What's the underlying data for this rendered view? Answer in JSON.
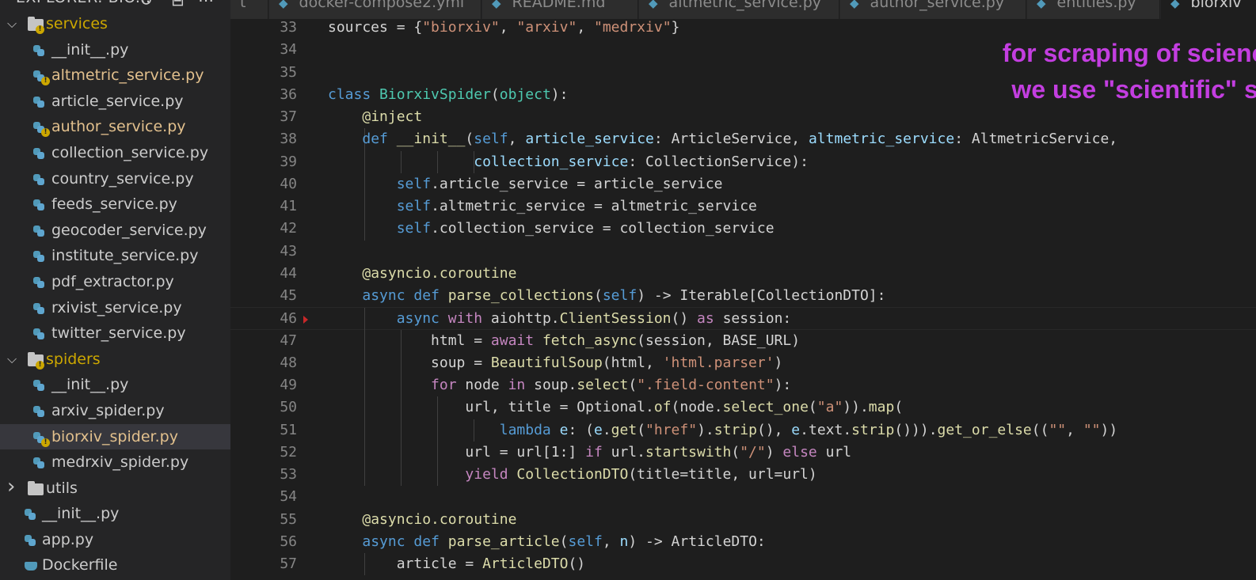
{
  "sidebar": {
    "title": "EXPLORER: BIO...",
    "tree": [
      {
        "label": "services",
        "type": "folder",
        "state": "expanded",
        "modified": true
      },
      {
        "label": "__init__.py",
        "type": "py"
      },
      {
        "label": "altmetric_service.py",
        "type": "py",
        "modified": true
      },
      {
        "label": "article_service.py",
        "type": "py"
      },
      {
        "label": "author_service.py",
        "type": "py",
        "modified": true
      },
      {
        "label": "collection_service.py",
        "type": "py"
      },
      {
        "label": "country_service.py",
        "type": "py"
      },
      {
        "label": "feeds_service.py",
        "type": "py"
      },
      {
        "label": "geocoder_service.py",
        "type": "py"
      },
      {
        "label": "institute_service.py",
        "type": "py"
      },
      {
        "label": "pdf_extractor.py",
        "type": "py"
      },
      {
        "label": "rxivist_service.py",
        "type": "py"
      },
      {
        "label": "twitter_service.py",
        "type": "py"
      },
      {
        "label": "spiders",
        "type": "folder",
        "state": "expanded",
        "modified": true
      },
      {
        "label": "__init__.py",
        "type": "py"
      },
      {
        "label": "arxiv_spider.py",
        "type": "py"
      },
      {
        "label": "biorxiv_spider.py",
        "type": "py",
        "modified": true,
        "selected": true
      },
      {
        "label": "medrxiv_spider.py",
        "type": "py"
      },
      {
        "label": "utils",
        "type": "folder",
        "state": "collapsed"
      },
      {
        "label": "__init__.py",
        "type": "py"
      },
      {
        "label": "app.py",
        "type": "py"
      },
      {
        "label": "Dockerfile",
        "type": "docker"
      }
    ]
  },
  "tabs": [
    {
      "label": "t"
    },
    {
      "label": "docker-compose2.yml"
    },
    {
      "label": "README.md"
    },
    {
      "label": "altmetric_service.py"
    },
    {
      "label": "author_service.py"
    },
    {
      "label": "entities.py"
    },
    {
      "label": "biorxiv",
      "active": true
    }
  ],
  "editor": {
    "lines": [
      {
        "n": "33",
        "code": "sources = {\"biorxiv\", \"arxiv\", \"medrxiv\"}"
      },
      {
        "n": "34",
        "code": ""
      },
      {
        "n": "35",
        "code": ""
      },
      {
        "n": "36",
        "code": "class BiorxivSpider(object):"
      },
      {
        "n": "37",
        "code": "    @inject"
      },
      {
        "n": "38",
        "code": "    def __init__(self, article_service: ArticleService, altmetric_service: AltmetricService,"
      },
      {
        "n": "39",
        "code": "                 collection_service: CollectionService):"
      },
      {
        "n": "40",
        "code": "        self.article_service = article_service"
      },
      {
        "n": "41",
        "code": "        self.altmetric_service = altmetric_service"
      },
      {
        "n": "42",
        "code": "        self.collection_service = collection_service"
      },
      {
        "n": "43",
        "code": ""
      },
      {
        "n": "44",
        "code": "    @asyncio.coroutine"
      },
      {
        "n": "45",
        "code": "    async def parse_collections(self) -> Iterable[CollectionDTO]:"
      },
      {
        "n": "46",
        "code": "        async with aiohttp.ClientSession() as session:"
      },
      {
        "n": "47",
        "code": "            html = await fetch_async(session, BASE_URL)"
      },
      {
        "n": "48",
        "code": "            soup = BeautifulSoup(html, 'html.parser')"
      },
      {
        "n": "49",
        "code": "            for node in soup.select(\".field-content\"):"
      },
      {
        "n": "50",
        "code": "                url, title = Optional.of(node.select_one(\"a\")).map("
      },
      {
        "n": "51",
        "code": "                    lambda e: (e.get(\"href\").strip(), e.text.strip())).get_or_else((\"\", \"\"))"
      },
      {
        "n": "52",
        "code": "                url = url[1:] if url.startswith(\"/\") else url"
      },
      {
        "n": "53",
        "code": "                yield CollectionDTO(title=title, url=url)"
      },
      {
        "n": "54",
        "code": ""
      },
      {
        "n": "55",
        "code": "    @asyncio.coroutine"
      },
      {
        "n": "56",
        "code": "    async def parse_article(self, n) -> ArticleDTO:"
      },
      {
        "n": "57",
        "code": "        article = ArticleDTO()"
      }
    ]
  },
  "annotation": {
    "line1": "for scraping of science articles,",
    "line2": "we use \"scientific\" scraping ;)"
  },
  "colors": {
    "annotation": "#c33ee0",
    "modified": "#e2c08d",
    "keyword": "#569cd6",
    "control": "#c586c0",
    "string": "#ce9178",
    "class": "#4ec9b0",
    "function": "#dcdcaa",
    "param": "#9cdcfe"
  }
}
